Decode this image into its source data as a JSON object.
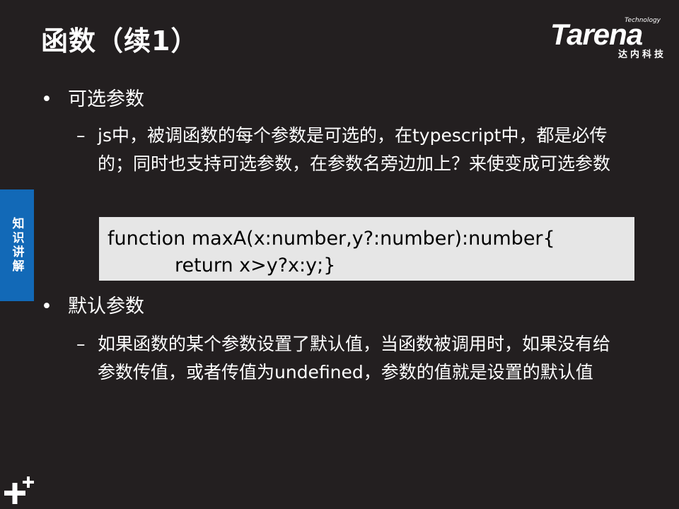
{
  "slide": {
    "title": "函数（续1）",
    "logo": {
      "name": "Tarena",
      "tag": "Technology",
      "cn": "达内科技"
    },
    "side_tab": "知识讲解",
    "bullets": [
      {
        "marker": "•",
        "heading": "可选参数",
        "sub_marker": "–",
        "sub": "js中，被调函数的每个参数是可选的，在typescript中，都是必传的；同时也支持可选参数，在参数名旁边加上？来使变成可选参数"
      },
      {
        "marker": "•",
        "heading": "默认参数",
        "sub_marker": "–",
        "sub": "如果函数的某个参数设置了默认值，当函数被调用时，如果没有给参数传值，或者传值为undefined，参数的值就是设置的默认值"
      }
    ],
    "code": {
      "line1": "function maxA(x:number,y?:number):number{",
      "line2": "return x>y?x:y;}"
    }
  },
  "colors": {
    "background": "#231f20",
    "side_tab": "#1269b7",
    "code_bg": "#e6e6e6"
  },
  "icons": {
    "corner": "plus-cross-icon"
  }
}
